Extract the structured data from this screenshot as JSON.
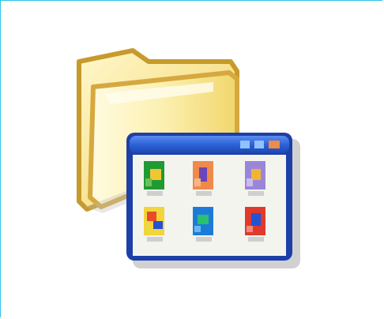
{
  "icon": {
    "name": "folder-with-program-window",
    "colors": {
      "border": "#2fc3e6",
      "folder_light": "#fff6c2",
      "folder_mid": "#f6dd7a",
      "folder_dark": "#d8a632",
      "window_border": "#1d3fa8",
      "title_bar": "#2d63d8",
      "window_bg": "#f4f4ef"
    },
    "mini_icons": [
      {
        "name": "green-yellow-file-icon",
        "primary": "#1f9a34",
        "secondary": "#f0c730"
      },
      {
        "name": "orange-purple-file-icon",
        "primary": "#f08a4a",
        "secondary": "#6a46b8"
      },
      {
        "name": "purple-yellow-file-icon",
        "primary": "#9a86d8",
        "secondary": "#f1b533"
      },
      {
        "name": "yellow-red-file-icon",
        "primary": "#f2d43b",
        "secondary": "#e84a2a"
      },
      {
        "name": "blue-green-file-icon",
        "primary": "#1d7bd8",
        "secondary": "#2ac06e"
      },
      {
        "name": "red-blue-file-icon",
        "primary": "#e03a2d",
        "secondary": "#2552d2"
      }
    ]
  }
}
